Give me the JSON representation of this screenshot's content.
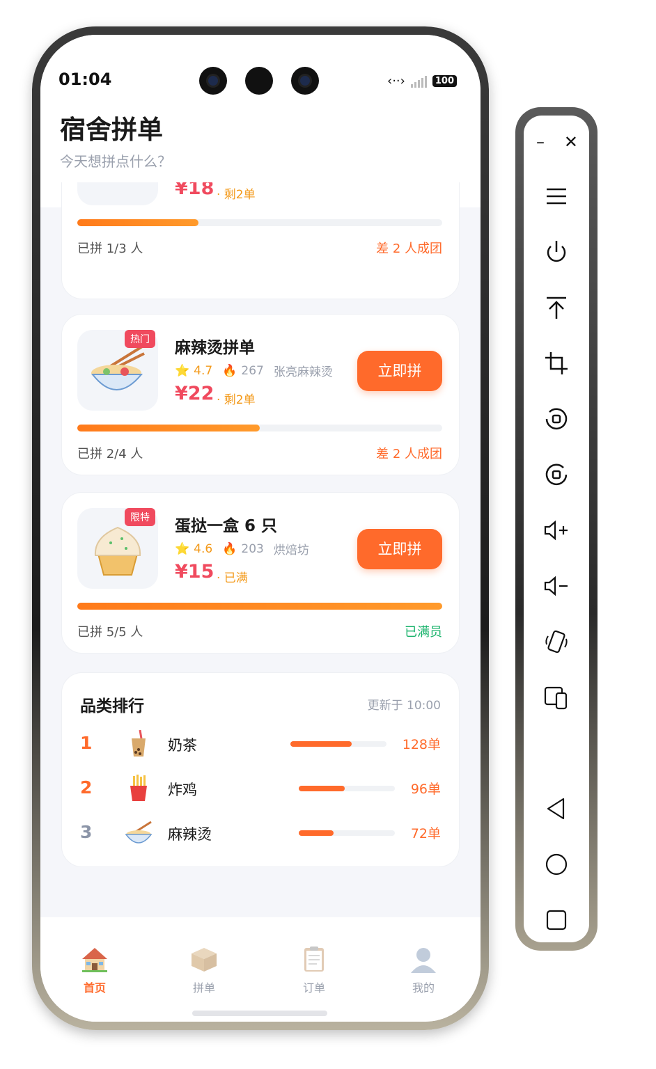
{
  "status_bar": {
    "time": "01:04",
    "battery": "100"
  },
  "header": {
    "title": "宿舍拼单",
    "subtitle": "今天想拼点什么？"
  },
  "cards": [
    {
      "price": "¥18",
      "remain": "· 剩2单",
      "progress": 0.333,
      "joined": "已拼 1/3 人",
      "status": "差 2 人成团"
    },
    {
      "tag": "热门",
      "name": "麻辣烫拼单",
      "rating": "4.7",
      "sold": "267",
      "shop": "张亮麻辣烫",
      "price": "¥22",
      "remain": "· 剩2单",
      "button": "立即拼",
      "progress": 0.5,
      "joined": "已拼 2/4 人",
      "status": "差 2 人成团",
      "icon": "noodle-bowl-icon"
    },
    {
      "tag": "限特",
      "name": "蛋挞一盒 6 只",
      "rating": "4.6",
      "sold": "203",
      "shop": "烘焙坊",
      "price": "¥15",
      "remain": "· 已满",
      "button": "立即拼",
      "progress": 1.0,
      "joined": "已拼 5/5 人",
      "status": "已满员",
      "icon": "cupcake-icon"
    }
  ],
  "ranking": {
    "title": "品类排行",
    "updated": "更新于 10:00",
    "items": [
      {
        "rank": "1",
        "name": "奶茶",
        "count": "128单",
        "share": 0.64,
        "icon": "bubble-tea-icon"
      },
      {
        "rank": "2",
        "name": "炸鸡",
        "count": "96单",
        "share": 0.48,
        "icon": "fries-icon"
      },
      {
        "rank": "3",
        "name": "麻辣烫",
        "count": "72单",
        "share": 0.36,
        "icon": "noodle-bowl-icon"
      }
    ]
  },
  "tabs": [
    {
      "label": "首页",
      "icon": "house-icon",
      "active": true
    },
    {
      "label": "拼单",
      "icon": "package-icon",
      "active": false
    },
    {
      "label": "订单",
      "icon": "clipboard-icon",
      "active": false
    },
    {
      "label": "我的",
      "icon": "user-icon",
      "active": false
    }
  ],
  "side_toolbar": {
    "buttons": [
      "minimize-icon",
      "close-icon",
      "menu-icon",
      "power-icon",
      "pin-top-icon",
      "crop-icon",
      "rotate-left-icon",
      "rotate-right-icon",
      "volume-up-icon",
      "volume-down-icon",
      "shake-icon",
      "device-switch-icon",
      "back-icon",
      "home-icon",
      "recents-icon"
    ]
  },
  "colors": {
    "accent": "#ff6a2b",
    "price": "#f04a5e",
    "success": "#17b26a",
    "rating": "#f39a1b"
  }
}
